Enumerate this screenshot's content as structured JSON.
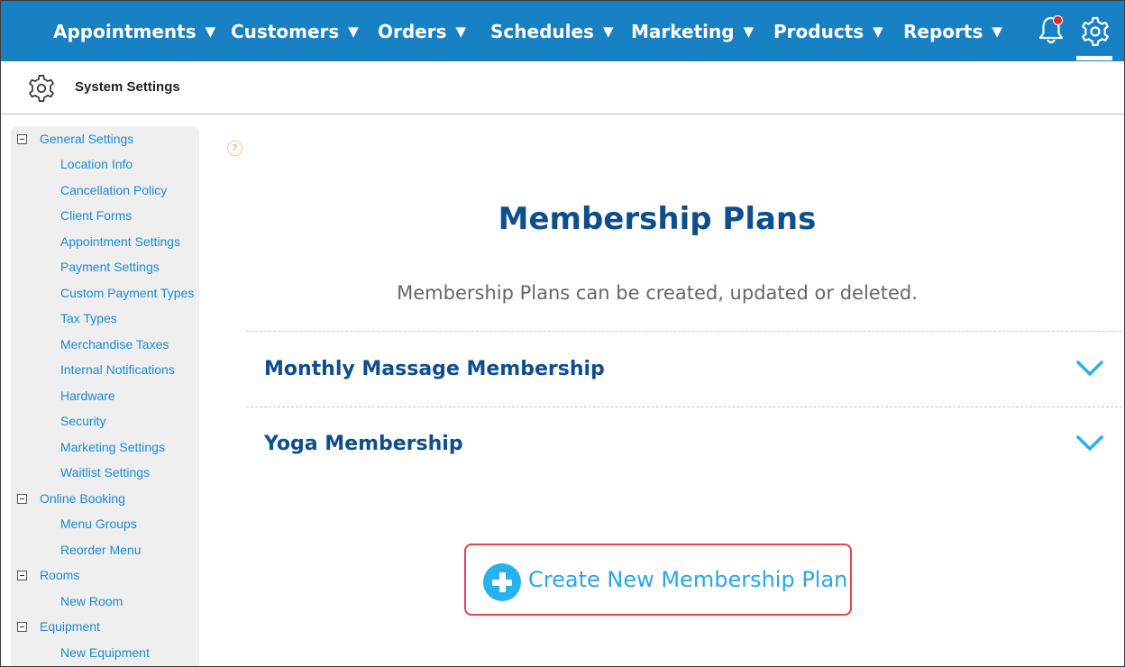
{
  "nav": {
    "items": [
      {
        "label": "Appointments",
        "caret": "▼"
      },
      {
        "label": "Customers",
        "caret": "▼"
      },
      {
        "label": "Orders",
        "caret": "▼"
      },
      {
        "label": "Schedules",
        "caret": "▼"
      },
      {
        "label": "Marketing",
        "caret": "▼"
      },
      {
        "label": "Products",
        "caret": "▼"
      },
      {
        "label": "Reports",
        "caret": "▼"
      }
    ],
    "bell_icon": "bell-icon",
    "settings_icon": "gear-icon",
    "notification_dot_color": "#e8262f",
    "bar_color": "#1781c4"
  },
  "subheader": {
    "icon": "gear-icon",
    "title": "System Settings"
  },
  "sidebar": {
    "groups": [
      {
        "label": "General Settings",
        "children": [
          "Location Info",
          "Cancellation Policy",
          "Client Forms",
          "Appointment Settings",
          "Payment Settings",
          "Custom Payment Types",
          "Tax Types",
          "Merchandise Taxes",
          "Internal Notifications",
          "Hardware",
          "Security",
          "Marketing Settings",
          "Waitlist Settings"
        ]
      },
      {
        "label": "Online Booking",
        "children": [
          "Menu Groups",
          "Reorder Menu"
        ]
      },
      {
        "label": "Rooms",
        "children": [
          "New Room"
        ]
      },
      {
        "label": "Equipment",
        "children": [
          "New Equipment"
        ]
      }
    ]
  },
  "main": {
    "help_icon_text": "?",
    "title": "Membership Plans",
    "subtitle": "Membership Plans can be created, updated or deleted.",
    "plans": [
      {
        "name": "Monthly Massage Membership"
      },
      {
        "name": "Yoga Membership"
      }
    ],
    "create_button": {
      "icon": "plus-circle-icon",
      "label": "Create New Membership Plan"
    },
    "accent_color": "#27b2ee",
    "title_color": "#0e4e8c",
    "highlight_border_color": "#e4434b"
  }
}
